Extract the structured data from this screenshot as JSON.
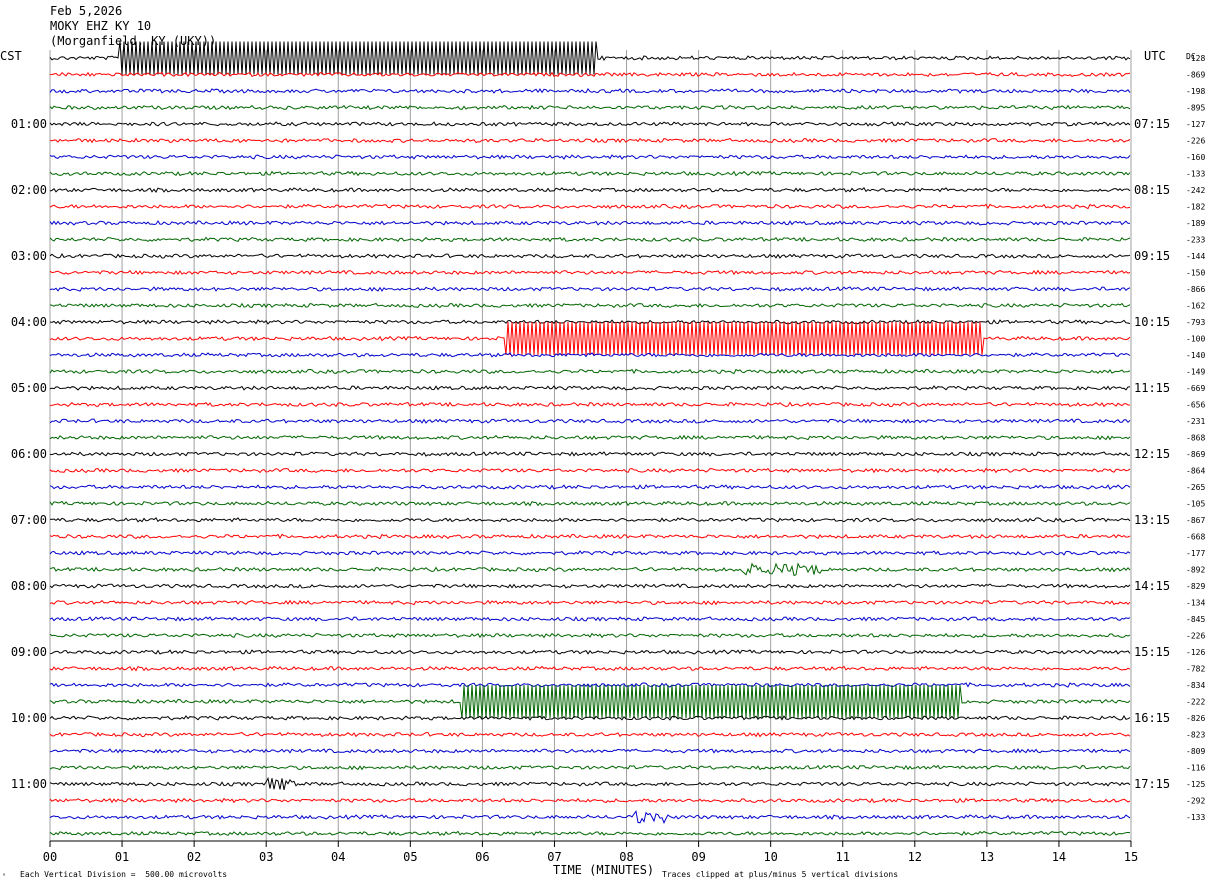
{
  "header": {
    "date": "Feb 5,2026",
    "station": "MOKY EHZ KY 10",
    "location": "(Morganfield, KY (UKY))"
  },
  "left_tz": "CST",
  "right_tz": "UTC",
  "dc_label": "DC",
  "footer": {
    "scale_text": "Each Vertical Division =  500.00 microvolts",
    "xlabel": "TIME (MINUTES)",
    "clip_text": "Traces clipped at plus/minus 5 vertical divisions"
  },
  "colors": {
    "trace": [
      "#000000",
      "#ff0000",
      "#0000cc",
      "#006600"
    ],
    "grid": "#a0a0a0"
  },
  "chart_data": {
    "type": "line",
    "title": "MOKY EHZ KY 10",
    "xlabel": "TIME (MINUTES)",
    "xlim": [
      0,
      15
    ],
    "x_ticks": [
      "00",
      "01",
      "02",
      "03",
      "04",
      "05",
      "06",
      "07",
      "08",
      "09",
      "10",
      "11",
      "12",
      "13",
      "14",
      "15"
    ],
    "lines_per_hour": 4,
    "n_lines": 48,
    "left_hour_labels": [
      "01:00",
      "02:00",
      "03:00",
      "04:00",
      "05:00",
      "06:00",
      "07:00",
      "08:00",
      "09:00",
      "10:00",
      "11:00"
    ],
    "right_hour_labels": [
      "07:15",
      "08:15",
      "09:15",
      "10:15",
      "11:15",
      "12:15",
      "13:15",
      "14:15",
      "15:15",
      "16:15",
      "17:15"
    ],
    "dc_offsets": [
      "-128",
      "-869",
      "-198",
      "-895",
      "-127",
      "-226",
      "-160",
      "-133",
      "-242",
      "-182",
      "-189",
      "-233",
      "-144",
      "-150",
      "-866",
      "-162",
      "-793",
      "-100",
      "-140",
      "-149",
      "-669",
      "-656",
      "-231",
      "-868",
      "-869",
      "-864",
      "-265",
      "-105",
      "-867",
      "-668",
      "-177",
      "-892",
      "-829",
      "-134",
      "-845",
      "-226",
      "-126",
      "-782",
      "-834",
      "-222",
      "-826",
      "-823",
      "-809",
      "-116",
      "-125",
      "-292",
      "-133"
    ],
    "events": [
      {
        "line": 0,
        "start_min": 0.95,
        "end_min": 7.6,
        "type": "clipped"
      },
      {
        "line": 17,
        "start_min": 6.3,
        "end_min": 12.95,
        "type": "clipped"
      },
      {
        "line": 39,
        "start_min": 5.7,
        "end_min": 12.65,
        "type": "clipped"
      },
      {
        "line": 31,
        "start_min": 9.6,
        "end_min": 10.7,
        "type": "burst"
      },
      {
        "line": 44,
        "start_min": 3.0,
        "end_min": 3.4,
        "type": "burst"
      },
      {
        "line": 46,
        "start_min": 8.1,
        "end_min": 8.6,
        "type": "burst"
      }
    ]
  }
}
